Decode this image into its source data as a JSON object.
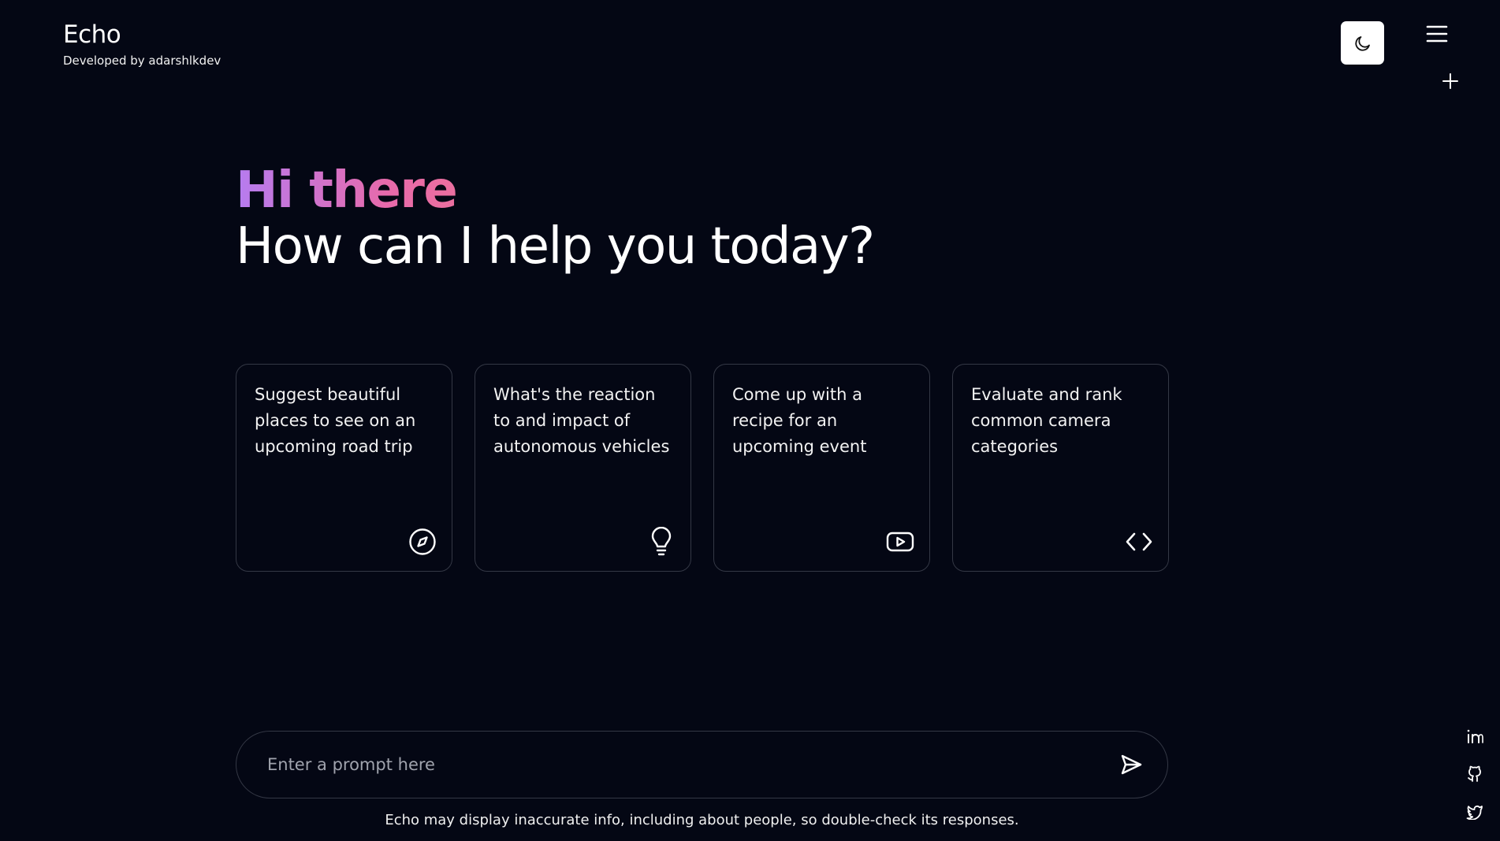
{
  "header": {
    "title": "Echo",
    "subtitle": "Developed by adarshlkdev",
    "theme_toggle_icon": "moon-icon",
    "menu_icon": "hamburger-menu-icon",
    "new_chat_icon": "plus-icon"
  },
  "greeting": {
    "hello": "Hi there",
    "question": "How can I help you today?",
    "gradient_colors": [
      "#b67cf0",
      "#e86aaa"
    ]
  },
  "cards": [
    {
      "text": "Suggest beautiful places to see on an upcoming road trip",
      "icon": "compass-icon"
    },
    {
      "text": "What's the reaction to and impact of autonomous vehicles",
      "icon": "lightbulb-icon"
    },
    {
      "text": "Come up with a recipe for an upcoming event",
      "icon": "youtube-icon"
    },
    {
      "text": "Evaluate and rank common camera categories",
      "icon": "code-icon"
    }
  ],
  "prompt": {
    "placeholder": "Enter a prompt here",
    "value": "",
    "send_icon": "send-icon"
  },
  "disclaimer": "Echo may display inaccurate info, including about people, so double-check its responses.",
  "social": [
    "linkedin-icon",
    "github-icon",
    "twitter-icon"
  ],
  "colors": {
    "background": "#040714",
    "card_border": "#343845",
    "text": "#ffffff"
  }
}
